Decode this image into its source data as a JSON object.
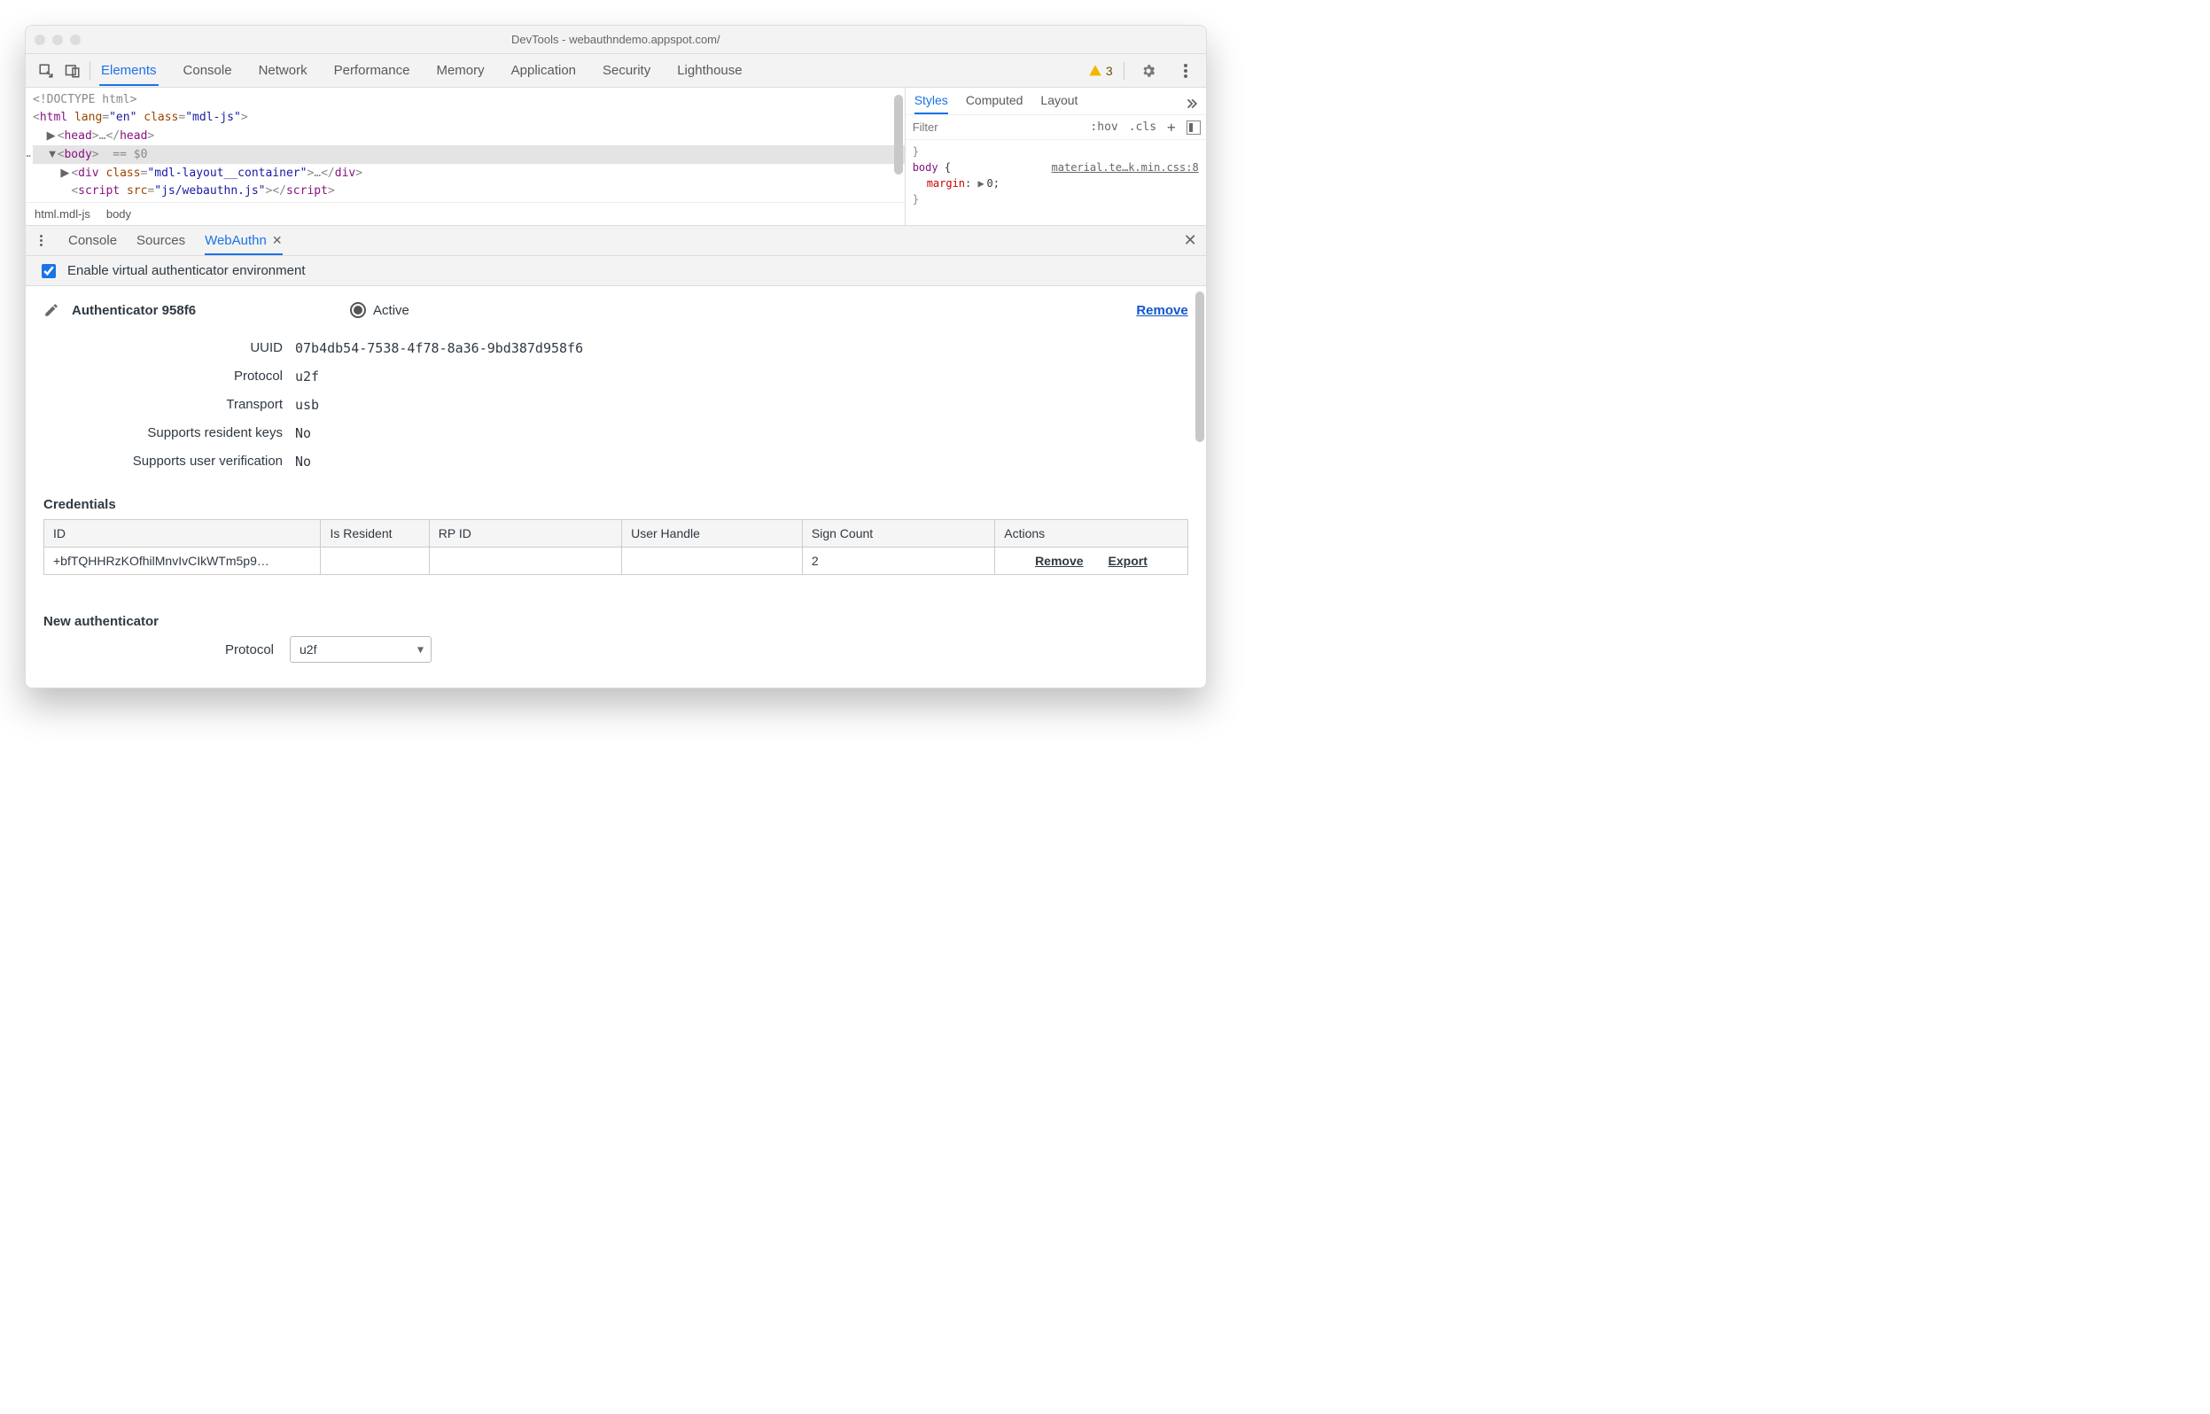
{
  "window": {
    "title": "DevTools - webauthndemo.appspot.com/"
  },
  "header": {
    "tabs": [
      "Elements",
      "Console",
      "Network",
      "Performance",
      "Memory",
      "Application",
      "Security",
      "Lighthouse"
    ],
    "active_tab": "Elements",
    "warn_count": "3"
  },
  "dom": {
    "l0": "<!DOCTYPE html>",
    "l1_open": "<",
    "l1_tag": "html",
    "l1_mid": " ",
    "l1_at1": "lang",
    "l1_eq1": "=",
    "l1_v1": "\"en\"",
    "l1_mid2": " ",
    "l1_at2": "class",
    "l1_eq2": "=",
    "l1_v2": "\"mdl-js\"",
    "l1_close": ">",
    "l2_pre": "  ",
    "l2_tri": "▶",
    "l2_o": "<",
    "l2_t": "head",
    "l2_c": ">",
    "l2_d": "…",
    "l2_e1": "</",
    "l2_e2": "head",
    "l2_e3": ">",
    "l3_pre": "  ",
    "l3_tri": "▼",
    "l3_o": "<",
    "l3_t": "body",
    "l3_c": ">",
    "l3_hint": "  == $0",
    "l3_ellipsis": "…",
    "l4_pre": "    ",
    "l4_tri": "▶",
    "l4_o": "<",
    "l4_t": "div",
    "l4_mid": " ",
    "l4_at": "class",
    "l4_eq": "=",
    "l4_v": "\"mdl-layout__container\"",
    "l4_c": ">",
    "l4_d": "…",
    "l4_e1": "</",
    "l4_e2": "div",
    "l4_e3": ">",
    "l5_pre": "    ",
    "l5_o": "<",
    "l5_t": "script",
    "l5_mid": " ",
    "l5_at": "src",
    "l5_eq": "=",
    "l5_v": "\"js/webauthn.js\"",
    "l5_c": ">",
    "l5_e1": "</",
    "l5_e2": "script",
    "l5_e3": ">"
  },
  "breadcrumb": {
    "a": "html.mdl-js",
    "b": "body"
  },
  "styles": {
    "tabs": [
      "Styles",
      "Computed",
      "Layout"
    ],
    "filter_placeholder": "Filter",
    "hov": ":hov",
    "cls": ".cls",
    "plus": "+",
    "brace_open": "}",
    "rule_selector": "body",
    "rule_open": " {",
    "rule_prop": "margin",
    "rule_colon": ": ",
    "rule_tri": "▶ ",
    "rule_val": "0;",
    "rule_link": "material.te…k.min.css:8",
    "brace_close": "}"
  },
  "drawer": {
    "tabs": [
      "Console",
      "Sources",
      "WebAuthn"
    ],
    "active": "WebAuthn",
    "enable_label": "Enable virtual authenticator environment"
  },
  "auth": {
    "title": "Authenticator 958f6",
    "active_label": "Active",
    "remove_label": "Remove",
    "fields": {
      "uuid_label": "UUID",
      "uuid": "07b4db54-7538-4f78-8a36-9bd387d958f6",
      "proto_label": "Protocol",
      "proto": "u2f",
      "trans_label": "Transport",
      "trans": "usb",
      "res_label": "Supports resident keys",
      "res": "No",
      "uv_label": "Supports user verification",
      "uv": "No"
    }
  },
  "cred": {
    "heading": "Credentials",
    "headers": {
      "id": "ID",
      "res": "Is Resident",
      "rp": "RP ID",
      "uh": "User Handle",
      "sc": "Sign Count",
      "act": "Actions"
    },
    "row": {
      "id": "+bfTQHHRzKOfhilMnvIvCIkWTm5p9…",
      "res": "",
      "rp": "",
      "uh": "",
      "sc": "2",
      "remove": "Remove",
      "export": "Export"
    }
  },
  "na": {
    "heading": "New authenticator",
    "proto_label": "Protocol",
    "proto_value": "u2f"
  }
}
